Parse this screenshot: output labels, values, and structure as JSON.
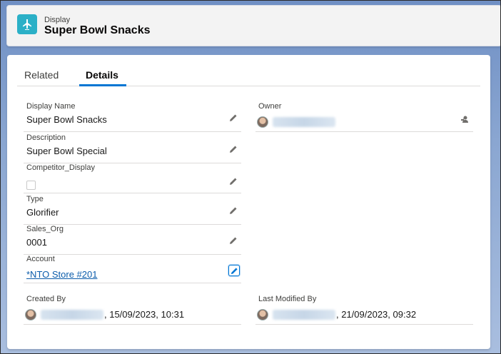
{
  "header": {
    "object_label": "Display",
    "record_title": "Super Bowl Snacks",
    "icon": "display-icon",
    "icon_color": "#2bb0c7"
  },
  "tabs": [
    {
      "label": "Related",
      "active": false
    },
    {
      "label": "Details",
      "active": true
    }
  ],
  "fields": {
    "display_name": {
      "label": "Display Name",
      "value": "Super Bowl Snacks"
    },
    "description": {
      "label": "Description",
      "value": "Super Bowl Special"
    },
    "competitor_display": {
      "label": "Competitor_Display",
      "checked": false
    },
    "type": {
      "label": "Type",
      "value": "Glorifier"
    },
    "sales_org": {
      "label": "Sales_Org",
      "value": "0001"
    },
    "account": {
      "label": "Account",
      "value": "*NTO Store #201"
    },
    "owner": {
      "label": "Owner"
    },
    "created_by": {
      "label": "Created By",
      "date": ", 15/09/2023, 10:31"
    },
    "last_modified_by": {
      "label": "Last Modified By",
      "date": ", 21/09/2023, 09:32"
    }
  },
  "colors": {
    "accent": "#0176d3",
    "link": "#0b5cab"
  }
}
